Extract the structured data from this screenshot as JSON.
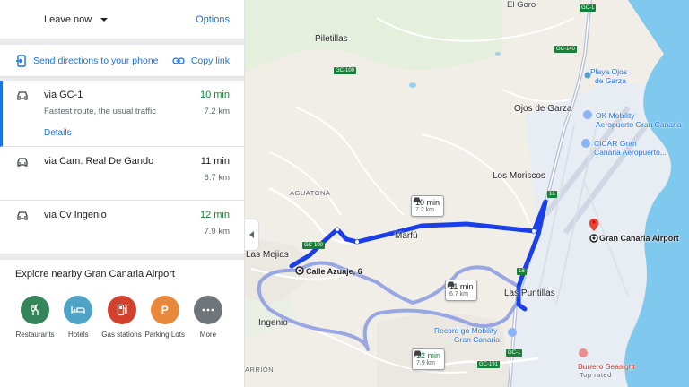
{
  "header": {
    "leave_label": "Leave now",
    "options_label": "Options"
  },
  "actions": {
    "send_label": "Send directions to your phone",
    "copy_label": "Copy link"
  },
  "routes": [
    {
      "via": "via GC-1",
      "time": "10 min",
      "desc": "Fastest route, the usual traffic",
      "dist": "7.2 km",
      "details": "Details"
    },
    {
      "via": "via Cam. Real De Gando",
      "time": "11 min",
      "dist": "6.7 km"
    },
    {
      "via": "via Cv Ingenio",
      "time": "12 min",
      "dist": "7.9 km"
    }
  ],
  "explore": {
    "title": "Explore nearby Gran Canaria Airport",
    "categories": [
      {
        "label": "Restaurants",
        "icon": "restaurant-icon",
        "color": "#34855a"
      },
      {
        "label": "Hotels",
        "icon": "hotel-icon",
        "color": "#4fa3c7"
      },
      {
        "label": "Gas stations",
        "icon": "gas-station-icon",
        "color": "#d2402e"
      },
      {
        "label": "Parking Lots",
        "icon": "parking-icon",
        "color": "#e8883a"
      },
      {
        "label": "More",
        "icon": "more-icon",
        "color": "#70757a"
      }
    ]
  },
  "map": {
    "places": {
      "el_goro": "El Goro",
      "piletillas": "Piletillas",
      "playa_ojos": "Playa Ojos",
      "playa_ojos2": "de Garza",
      "ojos_de_garza": "Ojos de Garza",
      "ok_mobility": "OK Mobility",
      "ok_mobility2": "Aeropuerto Gran Canaria",
      "cicar": "CICAR Gran",
      "cicar2": "Canaria Aeropuerto...",
      "los_moriscos": "Los Moriscos",
      "aguatona": "AGUATONA",
      "marfu": "Marfú",
      "las_mejias": "Las Mejias",
      "calle_azuaje": "Calle Azuaje, 6",
      "gran_canaria_airport": "Gran Canaria Airport",
      "las_puntillas": "Las Puntillas",
      "ingenio": "Ingenio",
      "record_go": "Record go Mobility",
      "record_go2": "Gran Canaria",
      "arrion": "ARRIÓN",
      "burrero": "Burrero Seasight",
      "burrero2": "Top rated"
    },
    "shields": {
      "gc1_a": "GC-1",
      "gc140": "GC-140",
      "gc100_a": "GC-100",
      "gc100_b": "GC-100",
      "gc1_b": "GC-1",
      "gc191": "GC-191",
      "n16": "16",
      "n18": "18"
    },
    "callouts": [
      {
        "time": "10 min",
        "dist": "7.2 km"
      },
      {
        "time": "11 min",
        "dist": "6.7 km"
      },
      {
        "time": "12 min",
        "dist": "7.9 km"
      }
    ]
  },
  "colors": {
    "accent": "#1a73e8",
    "green": "#188038",
    "route_primary": "#1a3fe8",
    "route_alt": "#9aa8e8",
    "sea": "#7fc8ee"
  }
}
